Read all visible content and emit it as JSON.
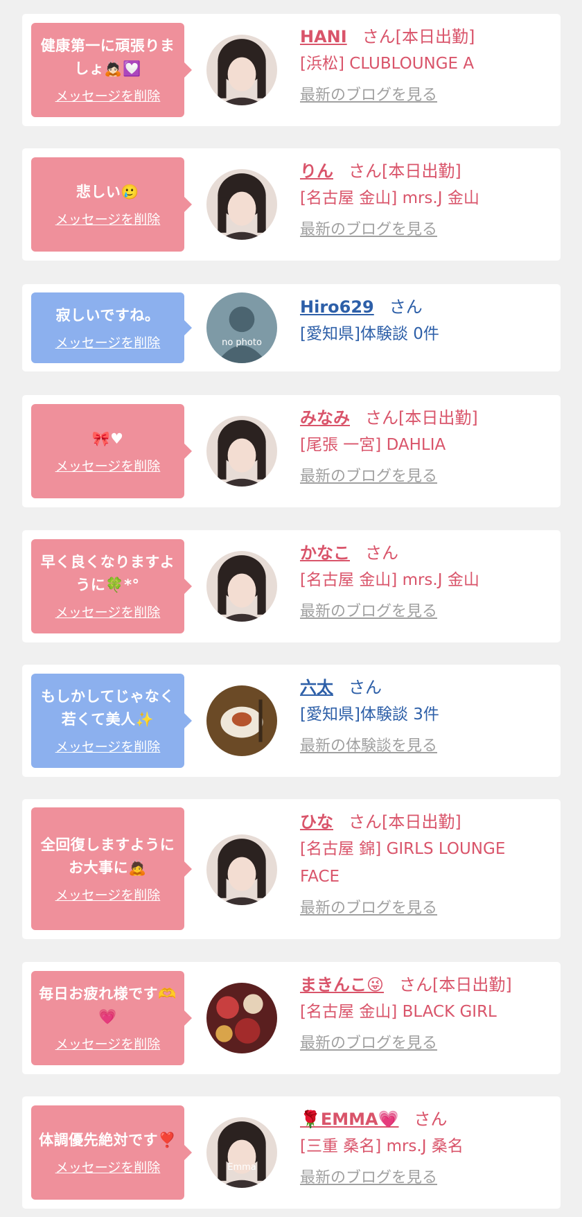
{
  "colors": {
    "pink_bubble": "#ef909b",
    "blue_bubble": "#8cb0ee",
    "pink_text": "#d9546a",
    "blue_text": "#2d5fa8",
    "link_gray": "#a0a0a0",
    "background": "#f0f0f0"
  },
  "items": [
    {
      "bubble_color": "pink",
      "message": "健康第一に頑張りましょ🙇🏻💟",
      "delete_label": "メッセージを削除",
      "name": "HANI",
      "name_color": "pink",
      "suffix": "さん[本日出勤]",
      "shop": "[浜松] CLUBLOUNGE A",
      "link": "最新のブログを見る",
      "avatar": "cast-photo"
    },
    {
      "bubble_color": "pink",
      "message": "悲しい🥲",
      "delete_label": "メッセージを削除",
      "name": "りん",
      "name_color": "pink",
      "suffix": "さん[本日出勤]",
      "shop": "[名古屋 金山] mrs.J 金山",
      "link": "最新のブログを見る",
      "avatar": "cast-photo"
    },
    {
      "bubble_color": "blue",
      "message": "寂しいですね。",
      "delete_label": "メッセージを削除",
      "name": "Hiro629",
      "name_color": "blue",
      "suffix": "さん",
      "shop": "[愛知県]体験談 0件",
      "link": "",
      "avatar": "no-photo",
      "avatar_text": "no photo"
    },
    {
      "bubble_color": "pink",
      "message": "🎀♥",
      "delete_label": "メッセージを削除",
      "name": "みなみ",
      "name_color": "pink",
      "suffix": "さん[本日出勤]",
      "shop": "[尾張 一宮] DAHLIA",
      "link": "最新のブログを見る",
      "avatar": "cast-photo"
    },
    {
      "bubble_color": "pink",
      "message": "早く良くなりますように🍀*°",
      "delete_label": "メッセージを削除",
      "name": "かなこ",
      "name_color": "pink",
      "suffix": "さん",
      "shop": "[名古屋 金山] mrs.J 金山",
      "link": "最新のブログを見る",
      "avatar": "cast-photo"
    },
    {
      "bubble_color": "blue",
      "message": "もしかしてじゃなく若くて美人✨",
      "delete_label": "メッセージを削除",
      "name": "六太",
      "name_color": "blue",
      "suffix": "さん",
      "shop": "[愛知県]体験談 3件",
      "link": "最新の体験談を見る",
      "avatar": "food-photo"
    },
    {
      "bubble_color": "pink",
      "message": "全回復しますようにお大事に🙇",
      "delete_label": "メッセージを削除",
      "name": "ひな",
      "name_color": "pink",
      "suffix": "さん[本日出勤]",
      "shop": "[名古屋 錦] GIRLS LOUNGE FACE",
      "link": "最新のブログを見る",
      "avatar": "cast-photo"
    },
    {
      "bubble_color": "pink",
      "message": "毎日お疲れ様です🫶💗",
      "delete_label": "メッセージを削除",
      "name": "まきんこ😜",
      "name_color": "pink",
      "suffix": "さん[本日出勤]",
      "shop": "[名古屋 金山] BLACK GIRL",
      "link": "最新のブログを見る",
      "avatar": "flower-photo"
    },
    {
      "bubble_color": "pink",
      "message": "体調優先絶対です❣️",
      "delete_label": "メッセージを削除",
      "name": "🌹EMMA💗",
      "name_color": "pink",
      "suffix": "さん",
      "shop": "[三重 桑名] mrs.J 桑名",
      "link": "最新のブログを見る",
      "avatar": "cast-photo",
      "avatar_text": "Emma"
    }
  ]
}
